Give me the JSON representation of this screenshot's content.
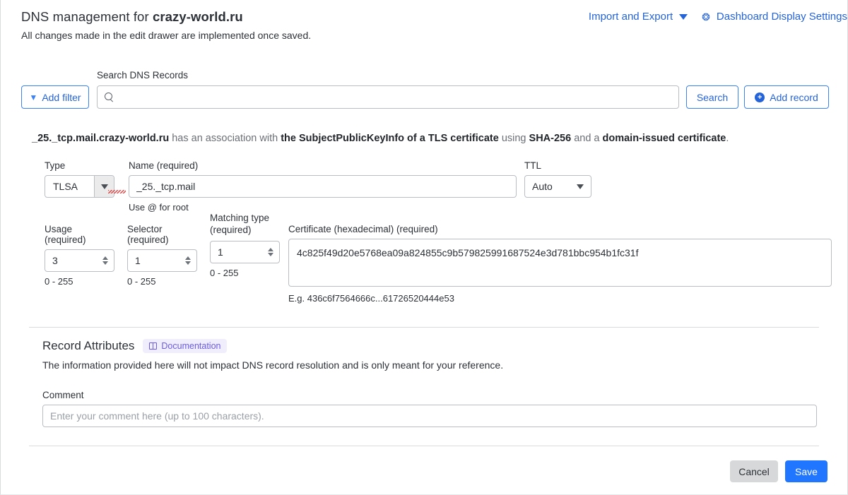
{
  "header": {
    "title_prefix": "DNS management for ",
    "domain": "crazy-world.ru",
    "subtitle": "All changes made in the edit drawer are implemented once saved.",
    "import_export_label": "Import and Export",
    "dashboard_settings_label": "Dashboard Display Settings",
    "gear_icon": "gear-icon",
    "caret_icon": "chevron-down-icon"
  },
  "search": {
    "add_filter_label": "Add filter",
    "funnel_icon": "funnel-icon",
    "label": "Search DNS Records",
    "value": "",
    "placeholder": "",
    "search_icon": "search-icon",
    "search_button_label": "Search",
    "add_record_label": "Add record",
    "add_record_icon": "plus-circle-icon"
  },
  "association": {
    "record_name": "_25._tcp.mail.crazy-world.ru",
    "text1": " has an association with ",
    "bold1": "the SubjectPublicKeyInfo of a TLS certificate",
    "text2": " using ",
    "bold2": "SHA-256",
    "text3": " and a ",
    "bold3": "domain-issued certificate",
    "text4": "."
  },
  "form": {
    "type": {
      "label": "Type",
      "value": "TLSA"
    },
    "name": {
      "label": "Name (required)",
      "value": "_25._tcp.mail",
      "helper": "Use @ for root"
    },
    "ttl": {
      "label": "TTL",
      "value": "Auto"
    },
    "usage": {
      "label": "Usage (required)",
      "value": "3",
      "helper": "0 - 255"
    },
    "selector": {
      "label": "Selector (required)",
      "value": "1",
      "helper": "0 - 255"
    },
    "matching_type": {
      "label": "Matching type\n(required)",
      "value": "1",
      "helper": "0 - 255"
    },
    "certificate": {
      "label": "Certificate (hexadecimal) (required)",
      "value": "4c825f49d20e5768ea09a824855c9b579825991687524e3d781bbc954b1fc31f",
      "helper": "E.g. 436c6f7564666c...61726520444e53"
    }
  },
  "record_attributes": {
    "title": "Record Attributes",
    "documentation_badge": "Documentation",
    "book_icon": "book-icon",
    "description": "The information provided here will not impact DNS record resolution and is only meant for your reference.",
    "comment_label": "Comment",
    "comment_value": "",
    "comment_placeholder": "Enter your comment here (up to 100 characters)."
  },
  "footer": {
    "cancel_label": "Cancel",
    "save_label": "Save"
  },
  "colors": {
    "accent_blue": "#2176ff",
    "link_blue": "#2563d9",
    "badge_purple": "#6b5ce7",
    "badge_bg": "#f0eefc",
    "cancel_grey": "#d7d8d9",
    "border_grey": "#babec3"
  }
}
